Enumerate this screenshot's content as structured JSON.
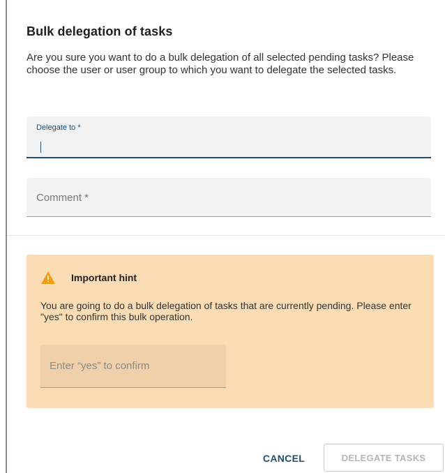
{
  "dialog": {
    "title": "Bulk delegation of tasks",
    "message": "Are you sure you want to do a bulk delegation of all selected pending tasks? Please choose the user or user group to which you want to delegate the selected tasks."
  },
  "fields": {
    "delegate_to": {
      "label": "Delegate to *",
      "value": ""
    },
    "comment": {
      "placeholder": "Comment *",
      "value": ""
    }
  },
  "hint": {
    "icon": "warning-icon",
    "title": "Important hint",
    "text": "You are going to do a bulk delegation of tasks that are currently pending. Please enter \"yes\" to confirm this bulk operation.",
    "confirm_placeholder": "Enter “yes” to confirm"
  },
  "actions": {
    "cancel_label": "CANCEL",
    "delegate_label": "DELEGATE TASKS"
  },
  "colors": {
    "accent": "#1e4f73",
    "hint_background": "#fcdcb5",
    "warning": "#f39c12"
  }
}
